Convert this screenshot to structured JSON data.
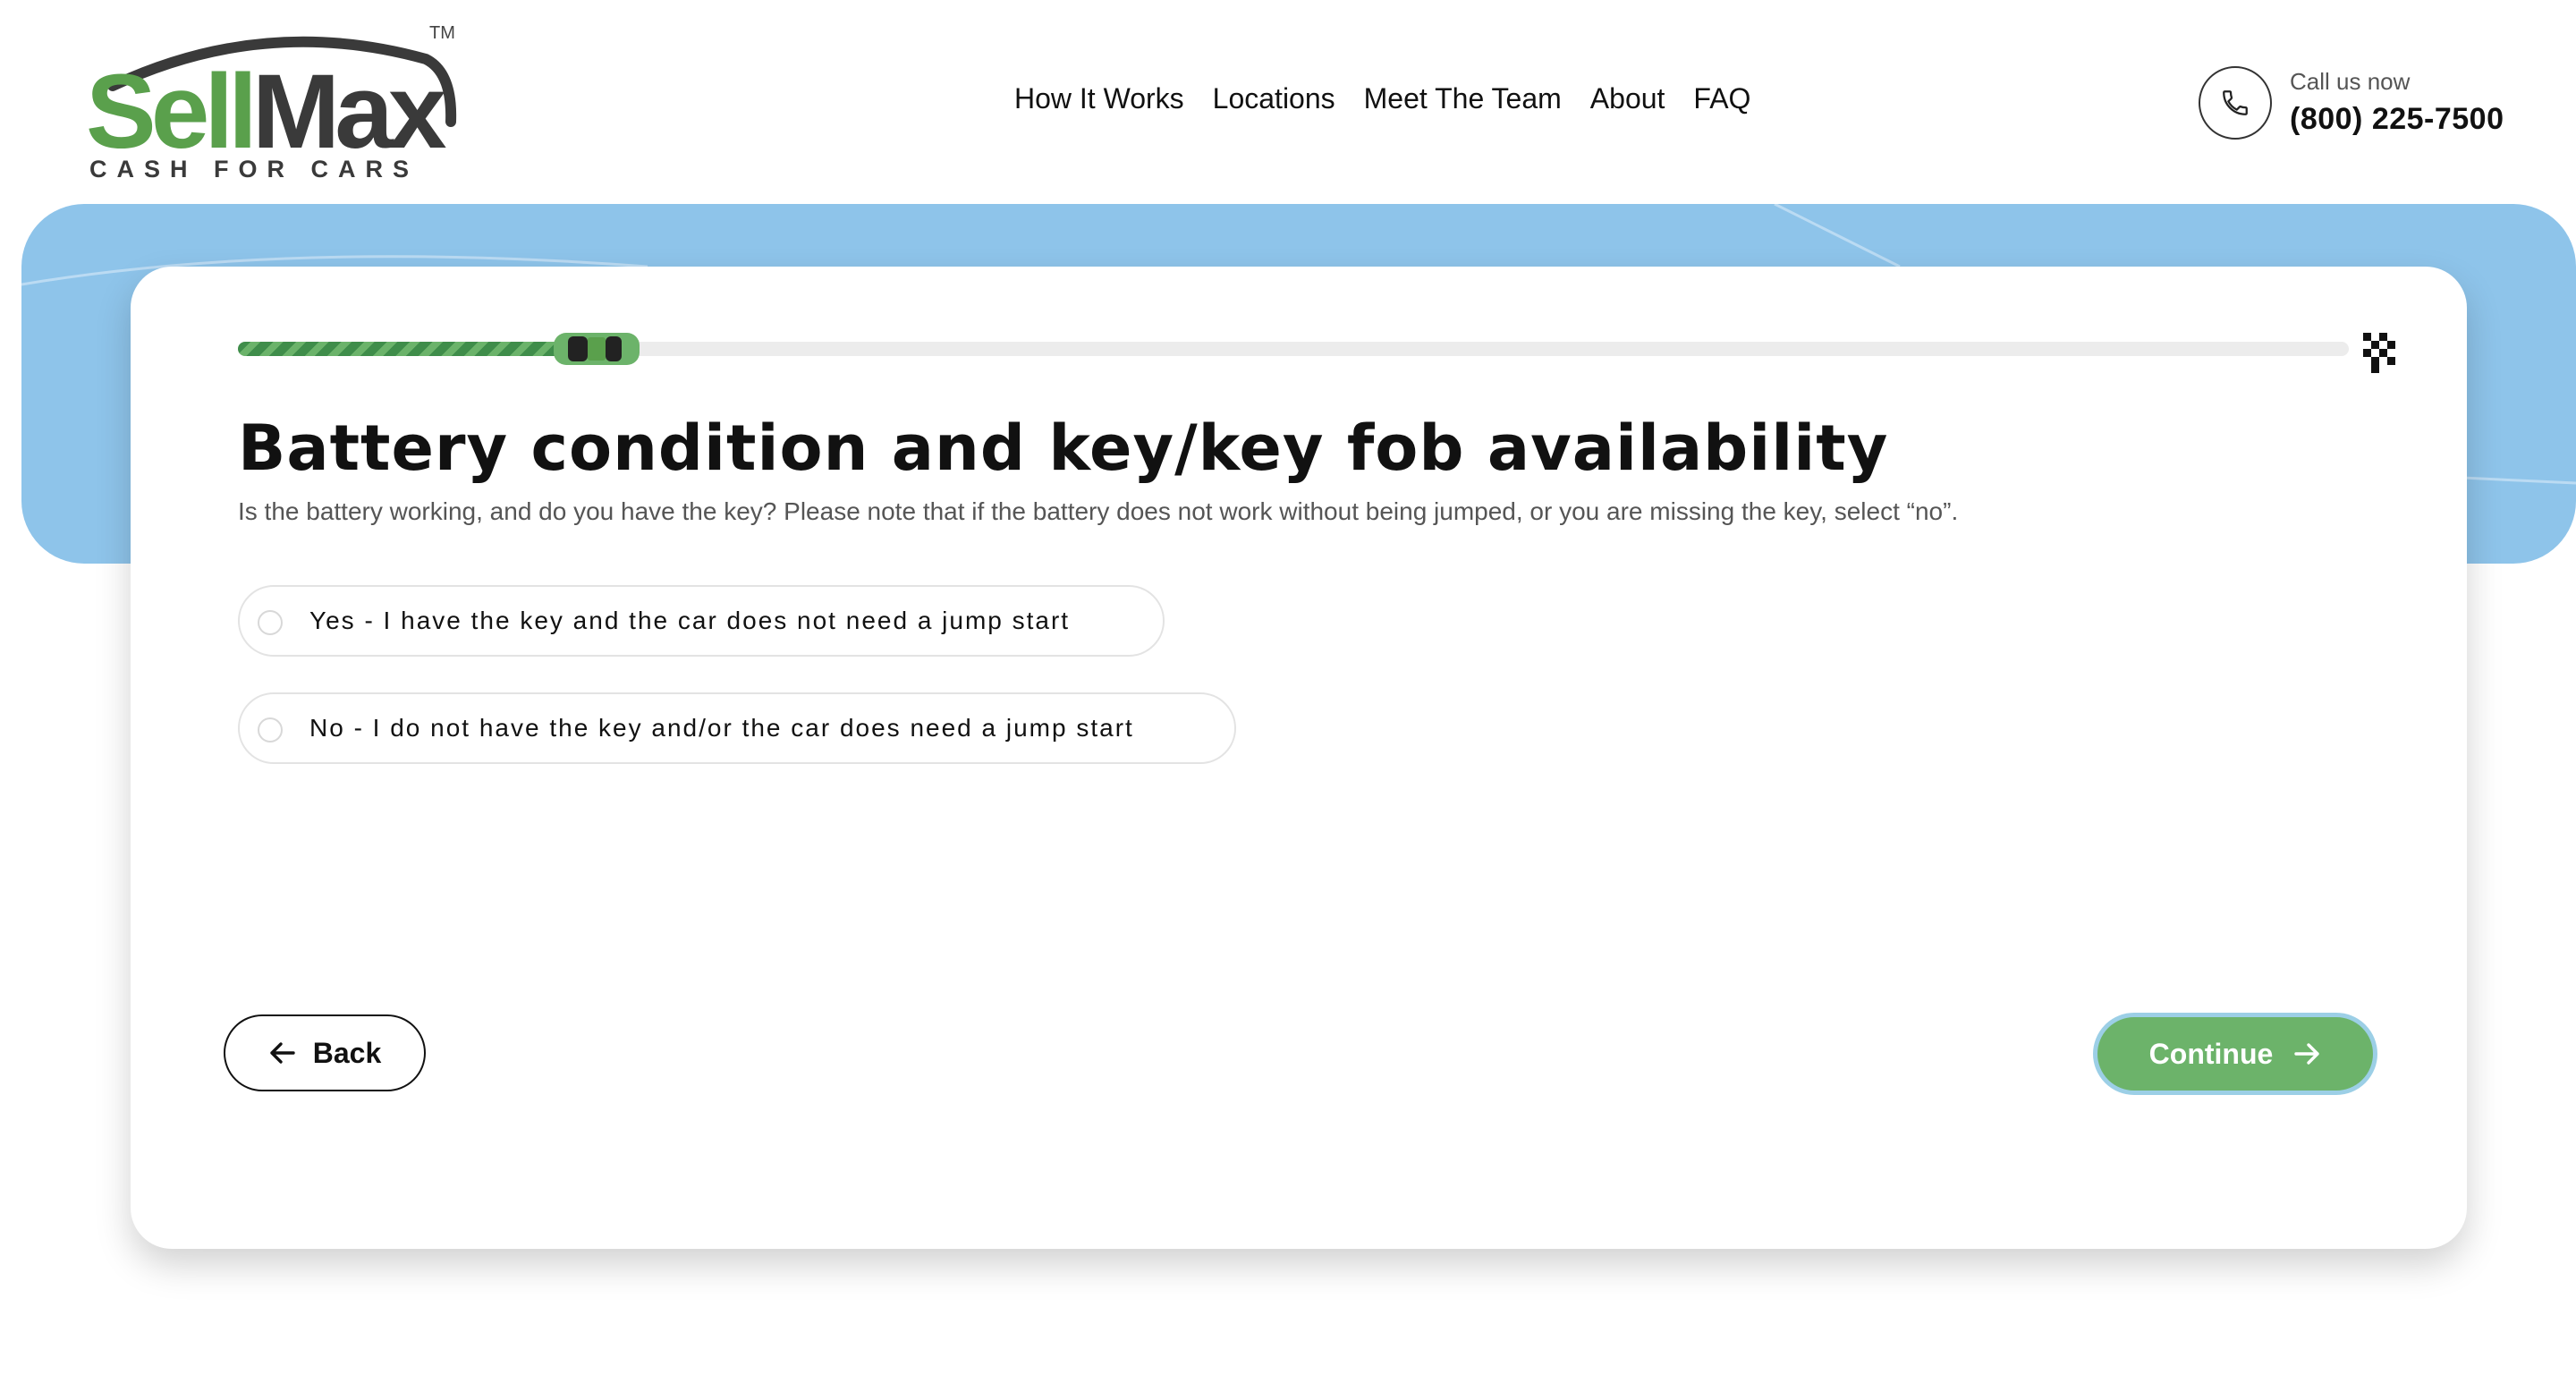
{
  "brand": {
    "logo_main_sell": "Sell",
    "logo_main_max": "Max",
    "logo_tagline": "CASH FOR CARS",
    "logo_tm": "TM"
  },
  "nav": {
    "items": [
      {
        "label": "How It Works"
      },
      {
        "label": "Locations"
      },
      {
        "label": "Meet The Team"
      },
      {
        "label": "About"
      },
      {
        "label": "FAQ"
      }
    ]
  },
  "contact": {
    "label": "Call us now",
    "phone": "(800) 225-7500",
    "icon": "phone-icon"
  },
  "progress": {
    "fraction": 0.18,
    "car_icon": "car-icon",
    "finish_icon": "checkered-flag-icon"
  },
  "question": {
    "title": "Battery condition and key/key fob availability",
    "description": "Is the battery working, and do you have the key? Please note that if the battery does not work without being jumped, or you are missing the key, select “no”.",
    "options": [
      {
        "label": "Yes - I have the key and the car does not need a jump start",
        "selected": false
      },
      {
        "label": "No - I do not have the key and/or the car does need a jump start",
        "selected": false
      }
    ]
  },
  "actions": {
    "back_label": "Back",
    "continue_label": "Continue"
  },
  "colors": {
    "brand_green": "#6cb36a",
    "hero_blue": "#8ec4ea",
    "progress_green": "#3f8d4a"
  }
}
